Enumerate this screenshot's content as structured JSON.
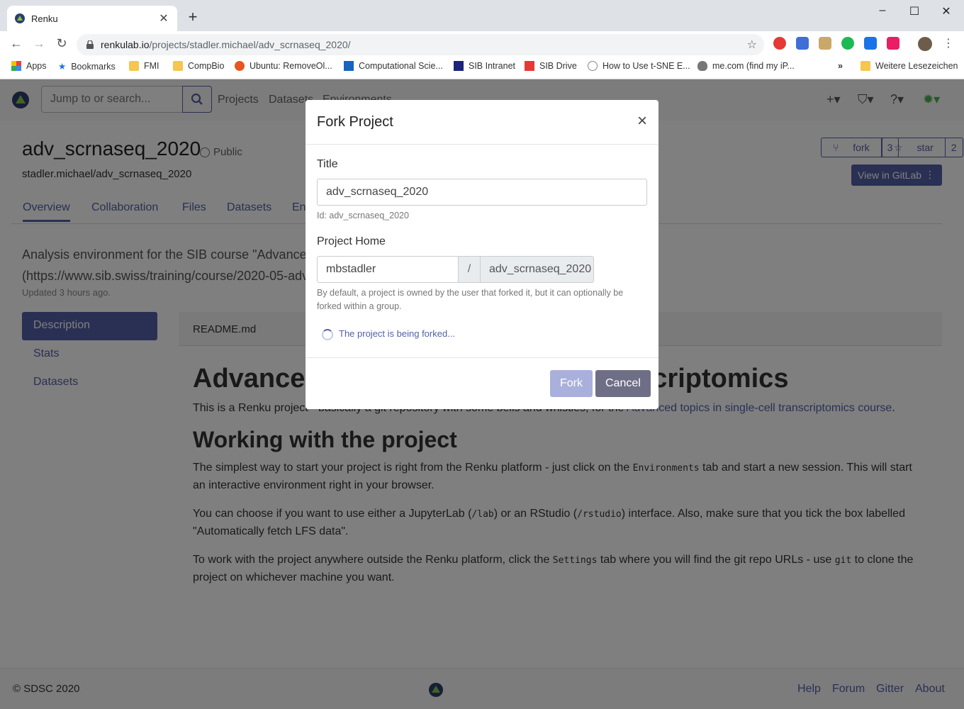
{
  "browser": {
    "tab_title": "Renku",
    "url_host": "renkulab.io",
    "url_path": "/projects/stadler.michael/adv_scrnaseq_2020/",
    "bookmarks": [
      "Apps",
      "Bookmarks",
      "FMI",
      "CompBio",
      "Ubuntu: RemoveOl...",
      "Computational Scie...",
      "SIB Intranet",
      "SIB Drive",
      "How to Use t-SNE E...",
      "me.com (find my iP...",
      "Weitere Lesezeichen"
    ],
    "overflow": "»"
  },
  "nav": {
    "search_placeholder": "Jump to or search...",
    "links": [
      "Projects",
      "Datasets",
      "Environments"
    ]
  },
  "project": {
    "title": "adv_scrnaseq_2020",
    "visibility": "Public",
    "path": "stadler.michael/adv_scrnaseq_2020",
    "fork_label": "fork",
    "fork_count": "3",
    "star_label": "star",
    "star_count": "2",
    "gitlab_label": "View in GitLab",
    "tabs": [
      "Overview",
      "Collaboration",
      "Files",
      "Datasets",
      "Environments"
    ],
    "description_line1": "Analysis environment for the SIB course \"Advanced topics in single-cell transcriptomics\"",
    "description_line2": "(https://www.sib.swiss/training/course/2020-05-adv-scrnaseq)",
    "updated": "Updated 3 hours ago."
  },
  "sidenav": [
    "Description",
    "Stats",
    "Datasets"
  ],
  "readme": {
    "file": "README.md",
    "h1": "Advanced topics in single-cell transcriptomics",
    "p1_pre": "This is a Renku project - basically a git repository with some bells and whistles, for the ",
    "p1_link": "Advanced topics in single-cell transcriptomics course",
    "p1_post": ".",
    "h2": "Working with the project",
    "p2_a": "The simplest way to start your project is right from the Renku platform - just click on the ",
    "p2_code": "Environments",
    "p2_b": " tab and start a new session. This will start an interactive environment right in your browser.",
    "p3_a": "You can choose if you want to use either a JupyterLab (",
    "p3_code1": "/lab",
    "p3_b": ") or an RStudio (",
    "p3_code2": "/rstudio",
    "p3_c": ") interface. Also, make sure that you tick the box labelled \"Automatically fetch LFS data\".",
    "p4_a": "To work with the project anywhere outside the Renku platform, click the ",
    "p4_code1": "Settings",
    "p4_b": " tab where you will find the git repo URLs - use ",
    "p4_code2": "git",
    "p4_c": " to clone the project on whichever machine you want."
  },
  "footer": {
    "copyright": "© SDSC 2020",
    "links": [
      "Help",
      "Forum",
      "Gitter",
      "About"
    ]
  },
  "modal": {
    "title": "Fork Project",
    "close": "×",
    "title_label": "Title",
    "title_value": "adv_scrnaseq_2020",
    "id_hint": "Id: adv_scrnaseq_2020",
    "home_label": "Project Home",
    "namespace": "mbstadler",
    "separator": "/",
    "slug": "adv_scrnaseq_2020",
    "home_hint_1": "By default, a project is owned by the user that forked it, but it can optionally be",
    "home_hint_2": "forked within a group.",
    "progress": "The project is being forked...",
    "fork_button": "Fork",
    "cancel_button": "Cancel"
  },
  "colors": {
    "primary": "#5561a6",
    "fork_disabled": "#a9b0db",
    "cancel": "#6e6e86"
  }
}
